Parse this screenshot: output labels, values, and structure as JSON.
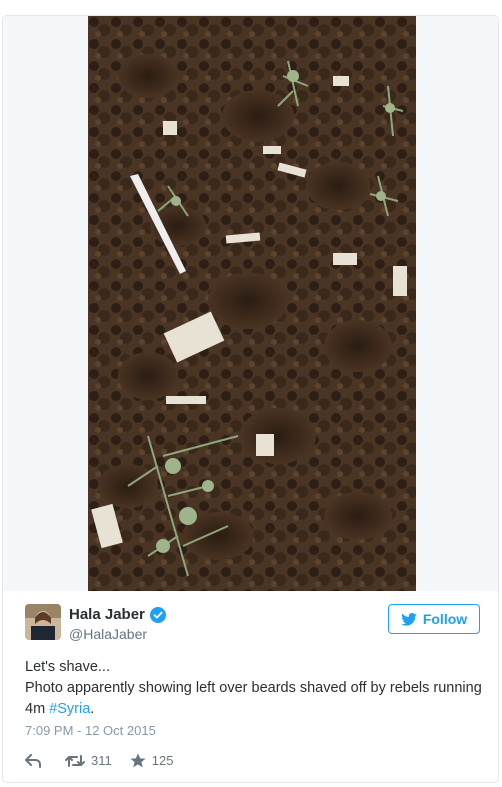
{
  "tweet": {
    "author_name": "Hala Jaber",
    "author_handle": "@HalaJaber",
    "follow_label": "Follow",
    "text_line1": "Let's shave...",
    "text_line2_prefix": "Photo apparently showing left over beards shaved off by rebels running 4m ",
    "hashtag": "#Syria",
    "text_line2_suffix": ".",
    "timestamp": "7:09 PM - 12 Oct 2015",
    "retweet_count": "311",
    "like_count": "125"
  },
  "icons": {
    "verified": "verified-badge-icon",
    "twitter_bird": "twitter-bird-icon",
    "reply": "reply-icon",
    "retweet": "retweet-icon",
    "like": "star-icon"
  },
  "colors": {
    "accent": "#1da1f2",
    "text": "#292f33",
    "muted": "#66757f",
    "timestamp": "#8899a6",
    "border": "#e1e8ed"
  }
}
